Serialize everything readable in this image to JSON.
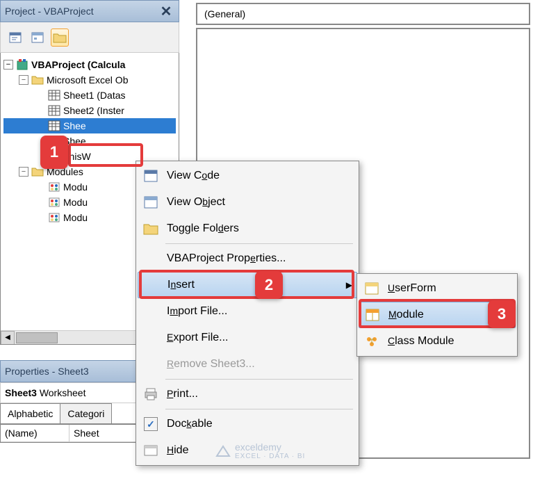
{
  "project_panel": {
    "title": "Project - VBAProject",
    "root": "VBAProject (Calcula",
    "excel_objects": "Microsoft Excel Ob",
    "sheets": [
      "Sheet1 (Datas",
      "Sheet2 (Inster",
      "Shee",
      "Shee"
    ],
    "selected_sheet": "Shee",
    "thisworkbook": "ThisW",
    "modules_folder": "Modules",
    "modules": [
      "Modu",
      "Modu",
      "Modu"
    ]
  },
  "properties_panel": {
    "title": "Properties - Sheet3",
    "object_label": "Sheet3",
    "object_type": "Worksheet",
    "tab_alphabetic": "Alphabetic",
    "tab_categorized": "Categori",
    "name_label": "(Name)",
    "name_value": "Sheet"
  },
  "general_dropdown": "(General)",
  "context_menu": {
    "view_code": "View Code",
    "view_object": "View Object",
    "toggle_folders": "Toggle Folders",
    "vba_properties": "VBAProject Properties...",
    "insert": "Insert",
    "import_file": "Import File...",
    "export_file": "Export File...",
    "remove": "Remove Sheet3...",
    "print": "Print...",
    "dockable": "Dockable",
    "hide": "Hide"
  },
  "submenu": {
    "userform": "UserForm",
    "module": "Module",
    "class_module": "Class Module"
  },
  "callouts": {
    "one": "1",
    "two": "2",
    "three": "3"
  },
  "watermark": {
    "name": "exceldemy",
    "tag": "EXCEL · DATA · BI"
  }
}
